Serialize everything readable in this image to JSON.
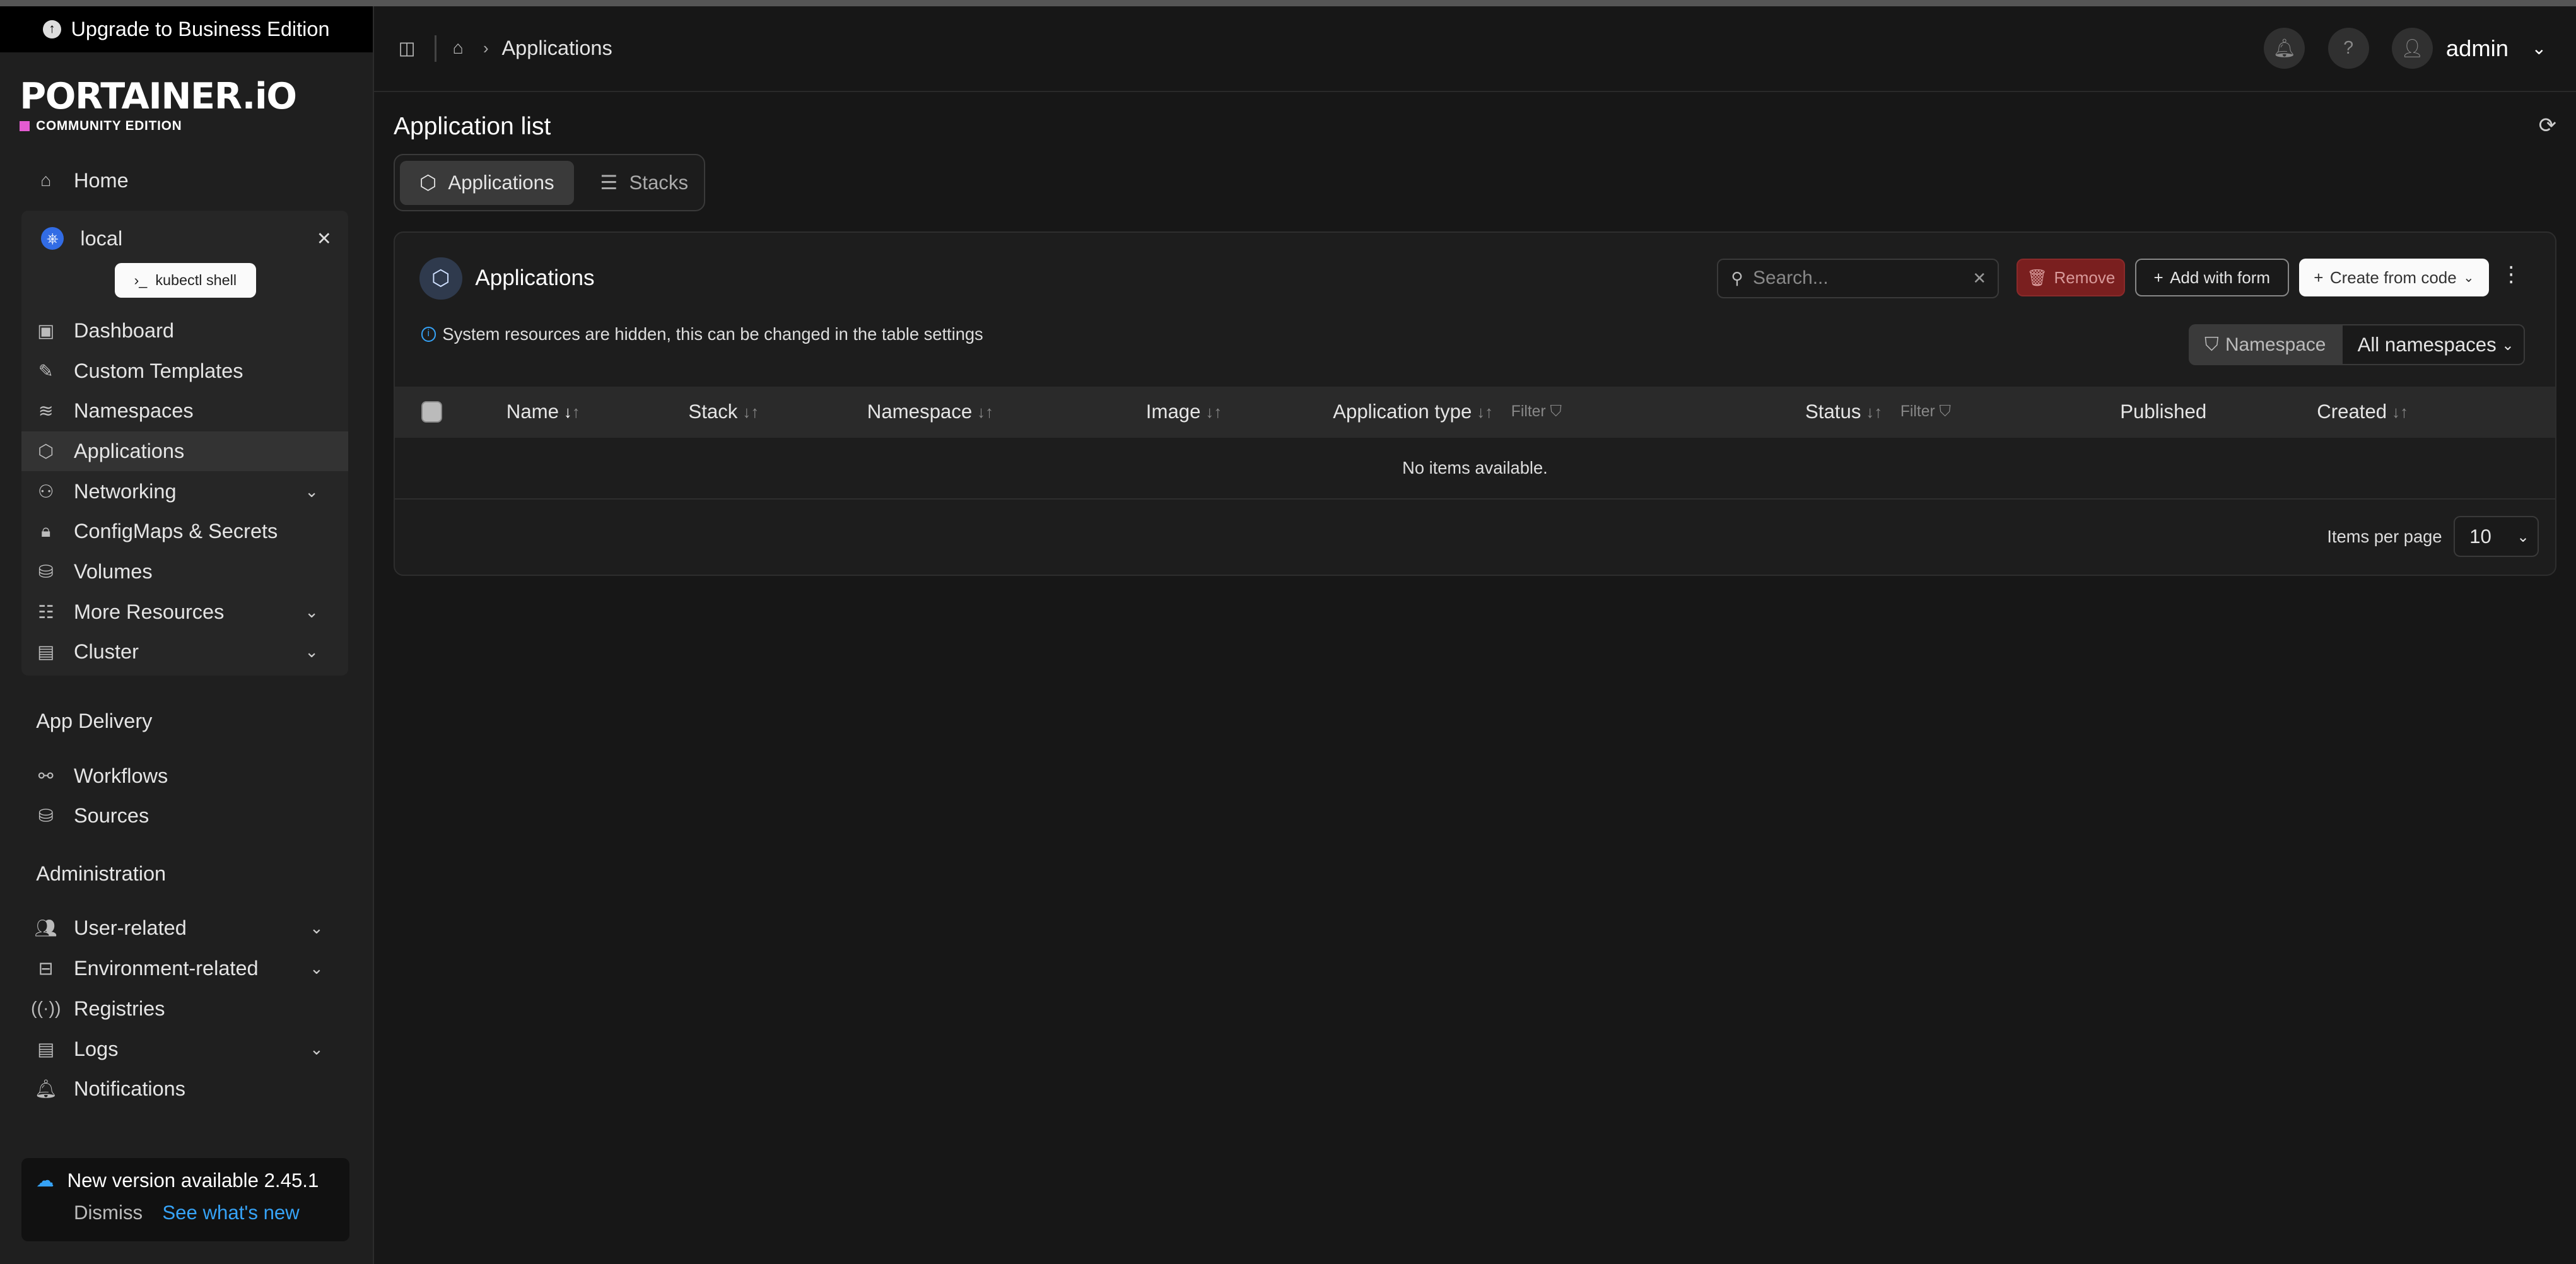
{
  "sidebar": {
    "upgrade_label": "Upgrade to Business Edition",
    "brand": "PORTAINER.iO",
    "edition": "COMMUNITY EDITION",
    "home_label": "Home",
    "environment": {
      "name": "local",
      "kubectl_label": "kubectl shell",
      "items": [
        {
          "label": "Dashboard",
          "icon": "dashboard-icon"
        },
        {
          "label": "Custom Templates",
          "icon": "edit-icon"
        },
        {
          "label": "Namespaces",
          "icon": "layers-icon"
        },
        {
          "label": "Applications",
          "icon": "box-icon"
        },
        {
          "label": "Networking",
          "icon": "network-icon"
        },
        {
          "label": "ConfigMaps & Secrets",
          "icon": "lock-icon"
        },
        {
          "label": "Volumes",
          "icon": "database-icon"
        },
        {
          "label": "More Resources",
          "icon": "list-icon"
        },
        {
          "label": "Cluster",
          "icon": "server-icon"
        }
      ]
    },
    "app_delivery": {
      "title": "App Delivery",
      "items": [
        {
          "label": "Workflows"
        },
        {
          "label": "Sources"
        }
      ]
    },
    "administration": {
      "title": "Administration",
      "items": [
        {
          "label": "User-related"
        },
        {
          "label": "Environment-related"
        },
        {
          "label": "Registries"
        },
        {
          "label": "Logs"
        },
        {
          "label": "Notifications"
        }
      ]
    },
    "update": {
      "message": "New version available 2.45.1",
      "dismiss": "Dismiss",
      "see_new": "See what's new"
    }
  },
  "header": {
    "breadcrumb": "Applications",
    "user": "admin"
  },
  "main": {
    "page_title": "Application list",
    "tabs": [
      {
        "label": "Applications"
      },
      {
        "label": "Stacks"
      }
    ],
    "panel": {
      "title": "Applications",
      "search_placeholder": "Search...",
      "remove_label": "Remove",
      "add_form_label": "Add with form",
      "create_code_label": "Create from code",
      "notice": "System resources are hidden, this can be changed in the table settings",
      "namespace_filter_label": "Namespace",
      "namespace_value": "All namespaces",
      "columns": {
        "name": "Name",
        "stack": "Stack",
        "namespace": "Namespace",
        "image": "Image",
        "app_type": "Application type",
        "status": "Status",
        "published": "Published",
        "created": "Created",
        "filter": "Filter"
      },
      "empty_message": "No items available.",
      "items_per_page_label": "Items per page",
      "items_per_page_value": "10"
    }
  }
}
